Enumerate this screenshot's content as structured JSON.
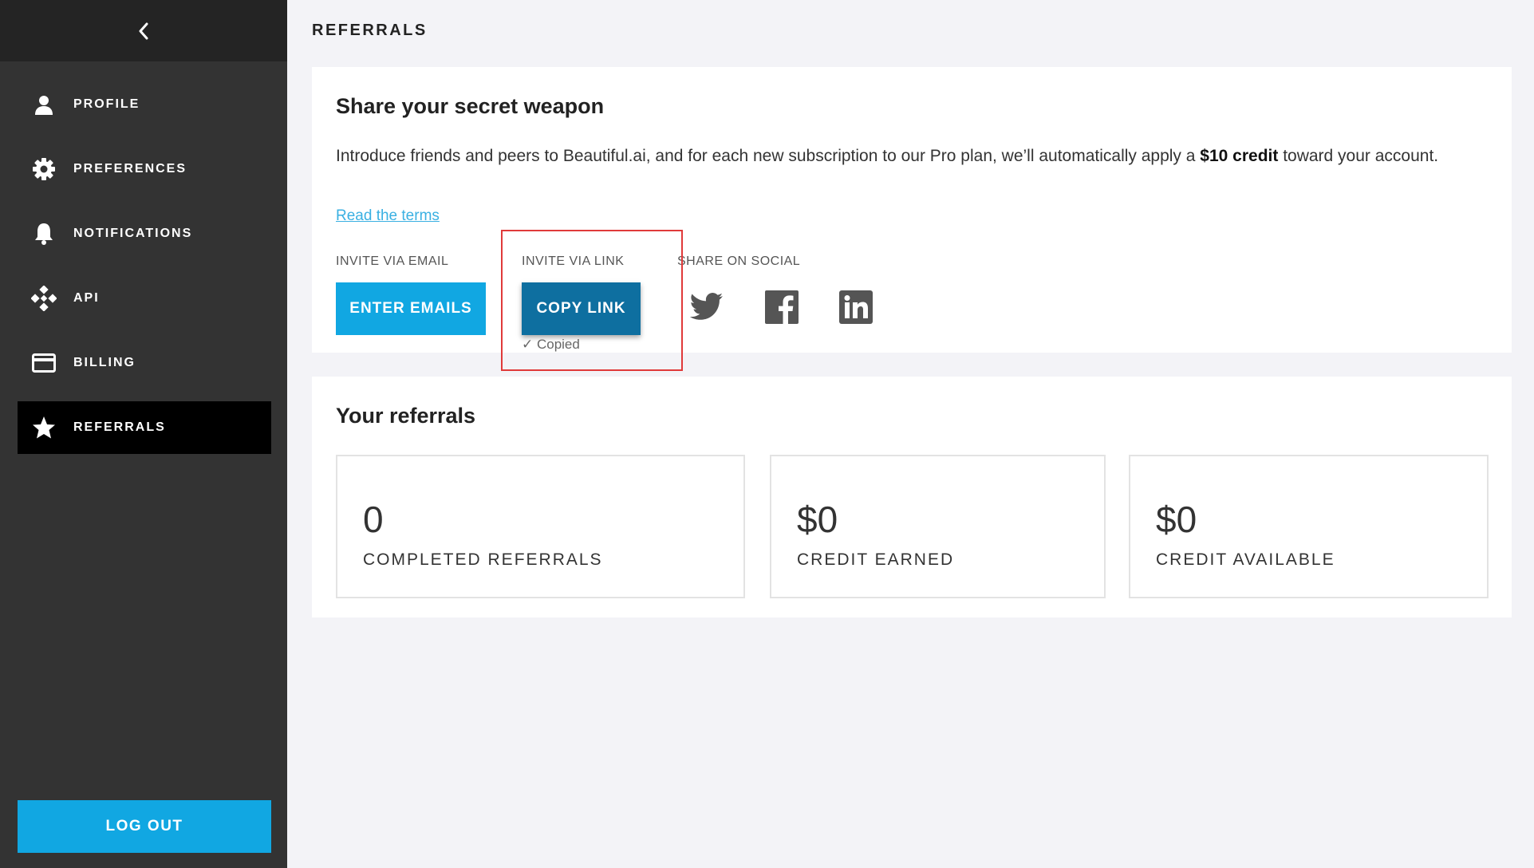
{
  "sidebar": {
    "back_icon": "chevron-left-icon",
    "items": [
      {
        "label": "PROFILE",
        "icon": "person-icon",
        "active": false
      },
      {
        "label": "PREFERENCES",
        "icon": "gear-icon",
        "active": false
      },
      {
        "label": "NOTIFICATIONS",
        "icon": "bell-icon",
        "active": false
      },
      {
        "label": "API",
        "icon": "api-icon",
        "active": false
      },
      {
        "label": "BILLING",
        "icon": "credit-card-icon",
        "active": false
      },
      {
        "label": "REFERRALS",
        "icon": "star-icon",
        "active": true
      }
    ],
    "logout_label": "LOG OUT"
  },
  "main": {
    "page_title": "REFERRALS",
    "share": {
      "heading": "Share your secret weapon",
      "body_before": "Introduce friends and peers to Beautiful.ai, and for each new subscription to our Pro plan, we’ll automatically apply a ",
      "body_bold": "$10 credit",
      "body_after": " toward your account.",
      "terms_link": "Read the terms",
      "invite_email_label": "INVITE VIA EMAIL",
      "invite_link_label": "INVITE VIA LINK",
      "share_social_label": "SHARE ON SOCIAL",
      "enter_emails_button": "ENTER EMAILS",
      "copy_link_button": "COPY LINK",
      "copied_status": "✓ Copied",
      "social_icons": [
        "twitter-icon",
        "facebook-icon",
        "linkedin-icon"
      ]
    },
    "referrals": {
      "heading": "Your referrals",
      "stats": [
        {
          "value": "0",
          "label": "COMPLETED REFERRALS"
        },
        {
          "value": "$0",
          "label": "CREDIT EARNED"
        },
        {
          "value": "$0",
          "label": "CREDIT AVAILABLE"
        }
      ]
    }
  },
  "colors": {
    "sidebar_bg": "#333333",
    "sidebar_top_bg": "#242424",
    "active_item_bg": "#000000",
    "accent_blue": "#11a7e2",
    "copy_button_blue": "#0e6fa0",
    "link_color": "#3ab0e2",
    "highlight_red": "#e03a3a",
    "icon_gray": "#555555"
  }
}
